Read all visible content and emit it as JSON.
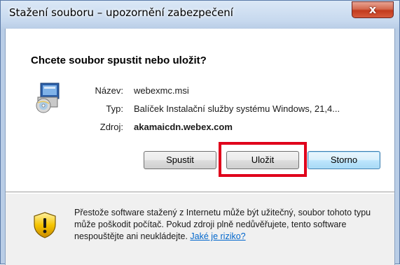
{
  "window": {
    "title": "Stažení souboru – upozornění zabezpečení",
    "close_label": "x"
  },
  "dialog": {
    "question": "Chcete soubor spustit nebo uložit?",
    "file_icon": "installer-package-icon",
    "fields": {
      "name_label": "Název:",
      "name_value": "webexmc.msi",
      "type_label": "Typ:",
      "type_value": "Balíček Instalační služby systému Windows, 21,4...",
      "source_label": "Zdroj:",
      "source_value": "akamaicdn.webex.com"
    },
    "buttons": {
      "run": "Spustit",
      "save": "Uložit",
      "cancel": "Storno"
    },
    "highlight_color": "#e0001b"
  },
  "warning": {
    "icon": "security-shield-warning-icon",
    "text": "Přestože software stažený z Internetu může být užitečný, soubor tohoto typu může poškodit počítač. Pokud zdroji plně nedůvěřujete, tento software nespouštějte ani neukládejte.",
    "link": "Jaké je riziko?"
  }
}
